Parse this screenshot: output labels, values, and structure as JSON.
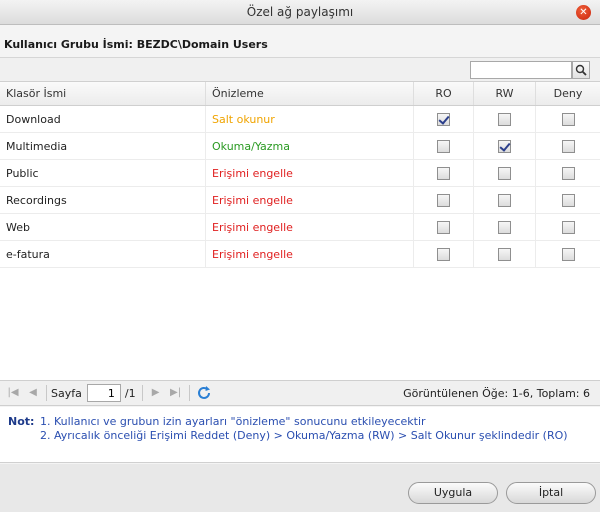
{
  "window": {
    "title": "Özel ağ paylaşımı",
    "close_icon": "close-icon"
  },
  "group": {
    "label": "Kullanıcı Grubu İsmi: BEZDC\\Domain Users"
  },
  "search": {
    "value": "",
    "placeholder": ""
  },
  "table": {
    "headers": [
      "Klasör İsmi",
      "Önizleme",
      "RO",
      "RW",
      "Deny"
    ],
    "rows": [
      {
        "name": "Download",
        "preview": "Salt okunur",
        "ro": true,
        "rw": false,
        "deny": false
      },
      {
        "name": "Multimedia",
        "preview": "Okuma/Yazma",
        "ro": false,
        "rw": true,
        "deny": false
      },
      {
        "name": "Public",
        "preview": "Erişimi engelle",
        "ro": false,
        "rw": false,
        "deny": false
      },
      {
        "name": "Recordings",
        "preview": "Erişimi engelle",
        "ro": false,
        "rw": false,
        "deny": false
      },
      {
        "name": "Web",
        "preview": "Erişimi engelle",
        "ro": false,
        "rw": false,
        "deny": false
      },
      {
        "name": "e-fatura",
        "preview": "Erişimi engelle",
        "ro": false,
        "rw": false,
        "deny": false
      }
    ]
  },
  "pager": {
    "page_label": "Sayfa",
    "page_value": "1",
    "page_total": "/1",
    "status": "Görüntülenen Öğe: 1-6, Toplam: 6"
  },
  "notes": {
    "label": "Not:",
    "line1": "1. Kullanıcı ve grubun izin ayarları \"önizleme\" sonucunu etkileyecektir",
    "line2": "2. Ayrıcalık önceliği Erişimi Reddet (Deny) > Okuma/Yazma (RW) > Salt Okunur şeklindedir (RO)"
  },
  "buttons": {
    "apply": "Uygula",
    "cancel": "İptal"
  },
  "colors": {
    "readonly": "#f0a400",
    "readwrite": "#2a9a22",
    "deny": "#e02020",
    "note": "#2a4eb0"
  }
}
